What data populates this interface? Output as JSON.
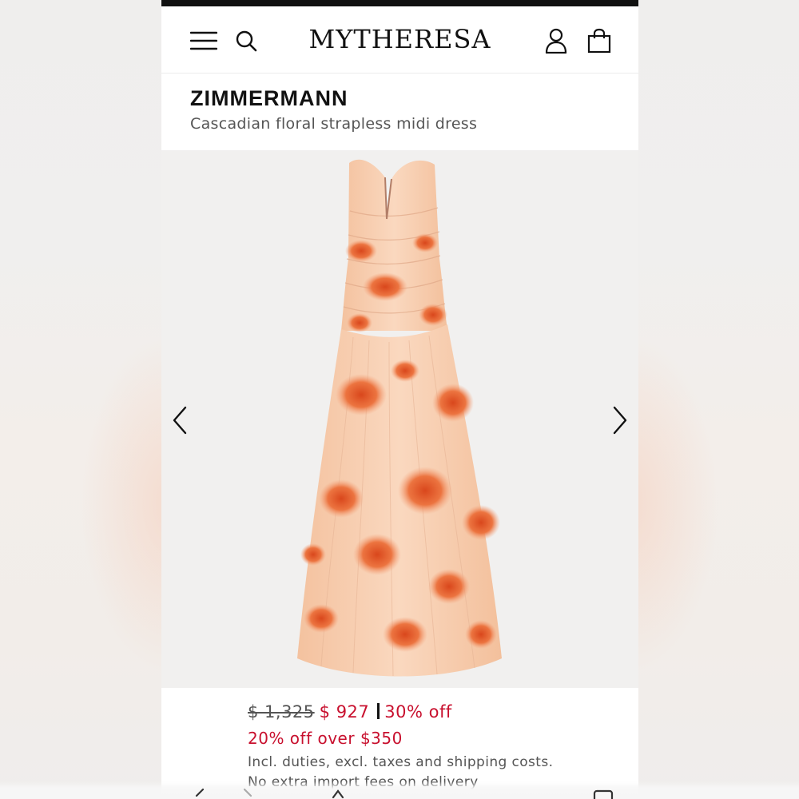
{
  "app": {
    "logo": "MYTHERESA"
  },
  "header": {
    "icons": [
      "menu-icon",
      "search-icon",
      "account-icon",
      "shopping-bag-icon"
    ]
  },
  "product": {
    "brand": "ZIMMERMANN",
    "name": "Cascadian floral strapless midi dress",
    "image": {
      "description_icon": "dress-image",
      "prev_icon": "chevron-left-icon",
      "next_icon": "chevron-right-icon"
    }
  },
  "pricing": {
    "original_price": "$ 1,325",
    "sale_price": "$ 927",
    "discount": "30% off",
    "promo": "20% off over $350",
    "tax_note": "Incl. duties, excl. taxes and shipping costs.",
    "import_note": "No extra import fees on delivery"
  },
  "colors": {
    "accent_red": "#c8102e",
    "text_dark": "#111111",
    "text_muted": "#555555",
    "dress_peach": "#f6c9a8",
    "dress_floral": "#e8682e"
  }
}
